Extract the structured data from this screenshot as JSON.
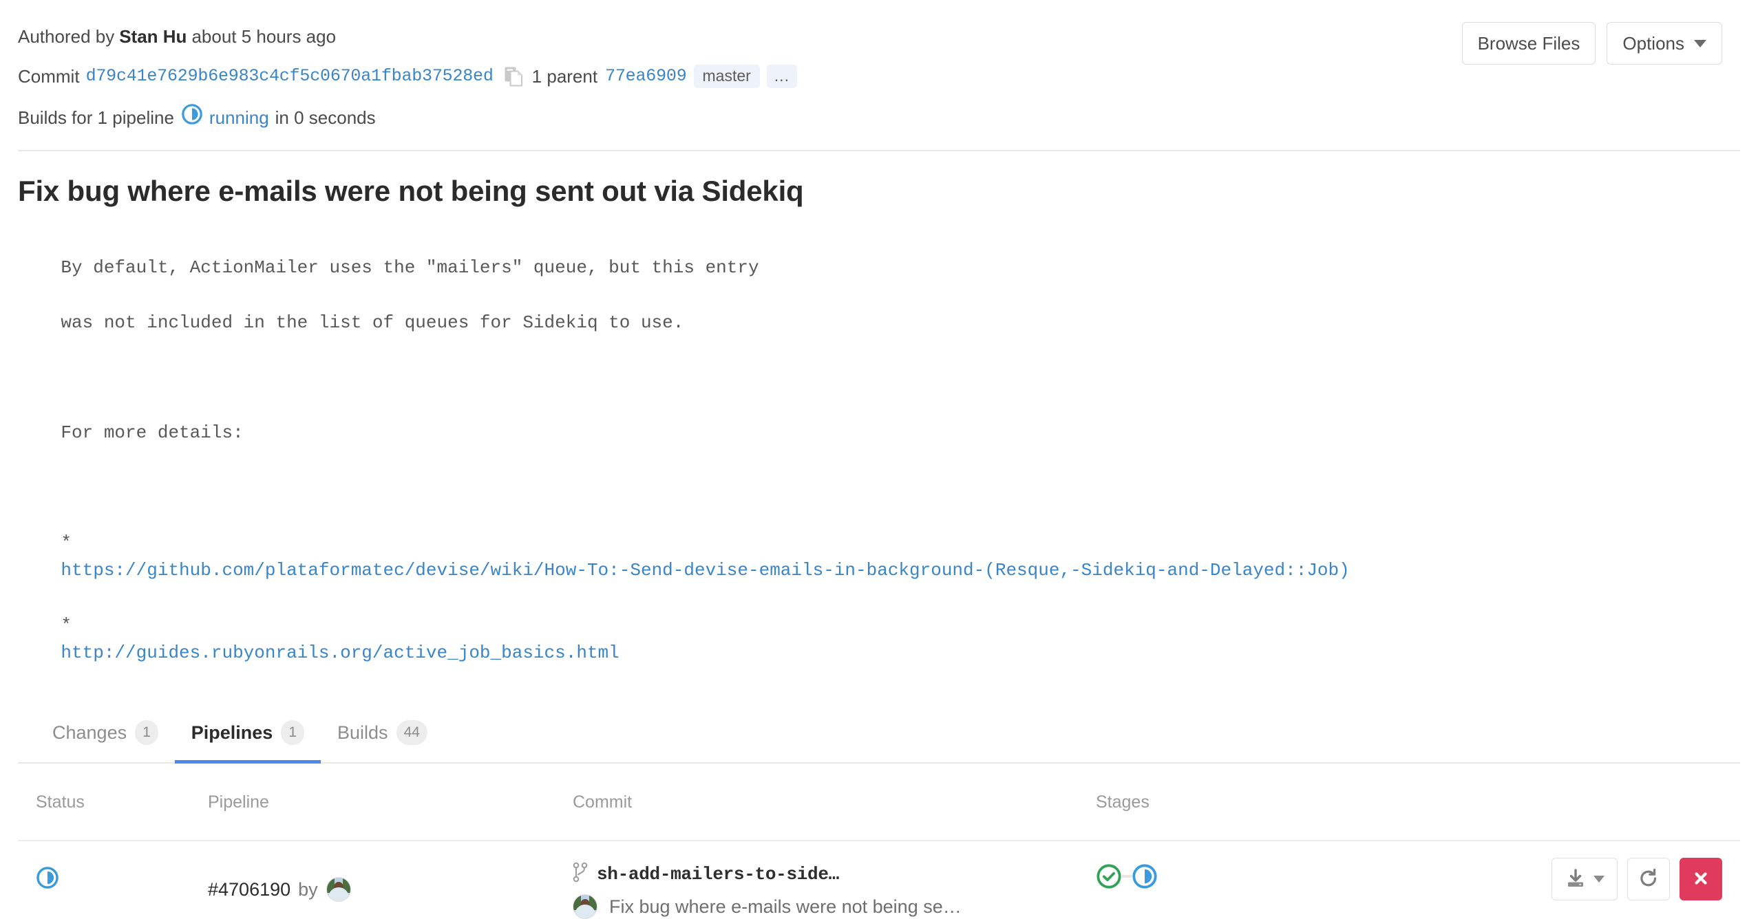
{
  "header": {
    "authored_prefix": "Authored by",
    "author": "Stan Hu",
    "authored_suffix": "about 5 hours ago",
    "commit_label": "Commit",
    "commit_sha": "d79c41e7629b6e983c4cf5c0670a1fbab37528ed",
    "copy_icon": "copy-to-clipboard-icon",
    "parent_label": "1 parent",
    "parent_sha": "77ea6909",
    "branch_badge": "master",
    "more_badge": "...",
    "builds_prefix": "Builds for 1 pipeline",
    "builds_status_icon": "running-icon",
    "builds_status": "running",
    "builds_suffix": "in 0 seconds"
  },
  "top_actions": {
    "browse_files": "Browse Files",
    "options": "Options",
    "options_caret_icon": "chevron-down-icon"
  },
  "commit": {
    "title": "Fix bug where e-mails were not being sent out via Sidekiq",
    "body_line1": "By default, ActionMailer uses the \"mailers\" queue, but this entry",
    "body_line2": "was not included in the list of queues for Sidekiq to use.",
    "body_line3": "",
    "body_line4": "For more details:",
    "body_line5": "",
    "bullet": "*",
    "link1": "https://github.com/plataformatec/devise/wiki/How-To:-Send-devise-emails-in-background-(Resque,-Sidekiq-and-Delayed::Job)",
    "link2": "http://guides.rubyonrails.org/active_job_basics.html"
  },
  "tabs": [
    {
      "label": "Changes",
      "count": "1",
      "active": false
    },
    {
      "label": "Pipelines",
      "count": "1",
      "active": true
    },
    {
      "label": "Builds",
      "count": "44",
      "active": false
    }
  ],
  "table": {
    "headers": {
      "status": "Status",
      "pipeline": "Pipeline",
      "commit": "Commit",
      "stages": "Stages",
      "actions": ""
    },
    "row": {
      "status_icon": "running-icon",
      "pipeline_id": "#4706190",
      "by": "by",
      "author_avatar": "avatar",
      "branch_icon": "branch-icon",
      "branch_name": "sh-add-mailers-to-side…",
      "commit_avatar": "avatar",
      "commit_message": "Fix bug where e-mails were not being se…",
      "stages": [
        {
          "name": "stage-passed",
          "icon": "check-circle-icon",
          "color": "#31a354"
        },
        {
          "name": "stage-running",
          "icon": "running-icon",
          "color": "#3a9bdc"
        }
      ],
      "actions": [
        {
          "name": "download-artifacts-button",
          "icon": "download-icon",
          "caret": "chevron-down-icon"
        },
        {
          "name": "retry-pipeline-button",
          "icon": "retry-icon"
        },
        {
          "name": "cancel-pipeline-button",
          "icon": "close-icon"
        }
      ]
    }
  },
  "colors": {
    "link": "#3a85c7",
    "running": "#3a9bdc",
    "passed": "#31a354",
    "danger": "#e03a5d",
    "tab_active": "#4a8bea"
  }
}
